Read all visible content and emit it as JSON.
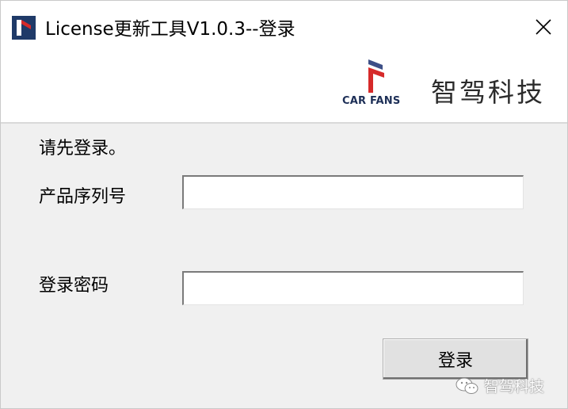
{
  "window": {
    "title": "License更新工具V1.0.3--登录",
    "close_glyph": "✕",
    "app_icon": "app-logo-icon"
  },
  "header": {
    "logo_caption": "CAR FANS",
    "brand_name": "智驾科技",
    "logo_colors": {
      "blue": "#3d4f87",
      "red": "#d62a2a",
      "navy": "#1d2f57"
    }
  },
  "form": {
    "prompt": "请先登录。",
    "serial_label": "产品序列号",
    "serial_value": "",
    "password_label": "登录密码",
    "password_value": "",
    "submit_label": "登录"
  },
  "watermark": {
    "text": "智驾科技",
    "icon": "wechat-icon"
  }
}
